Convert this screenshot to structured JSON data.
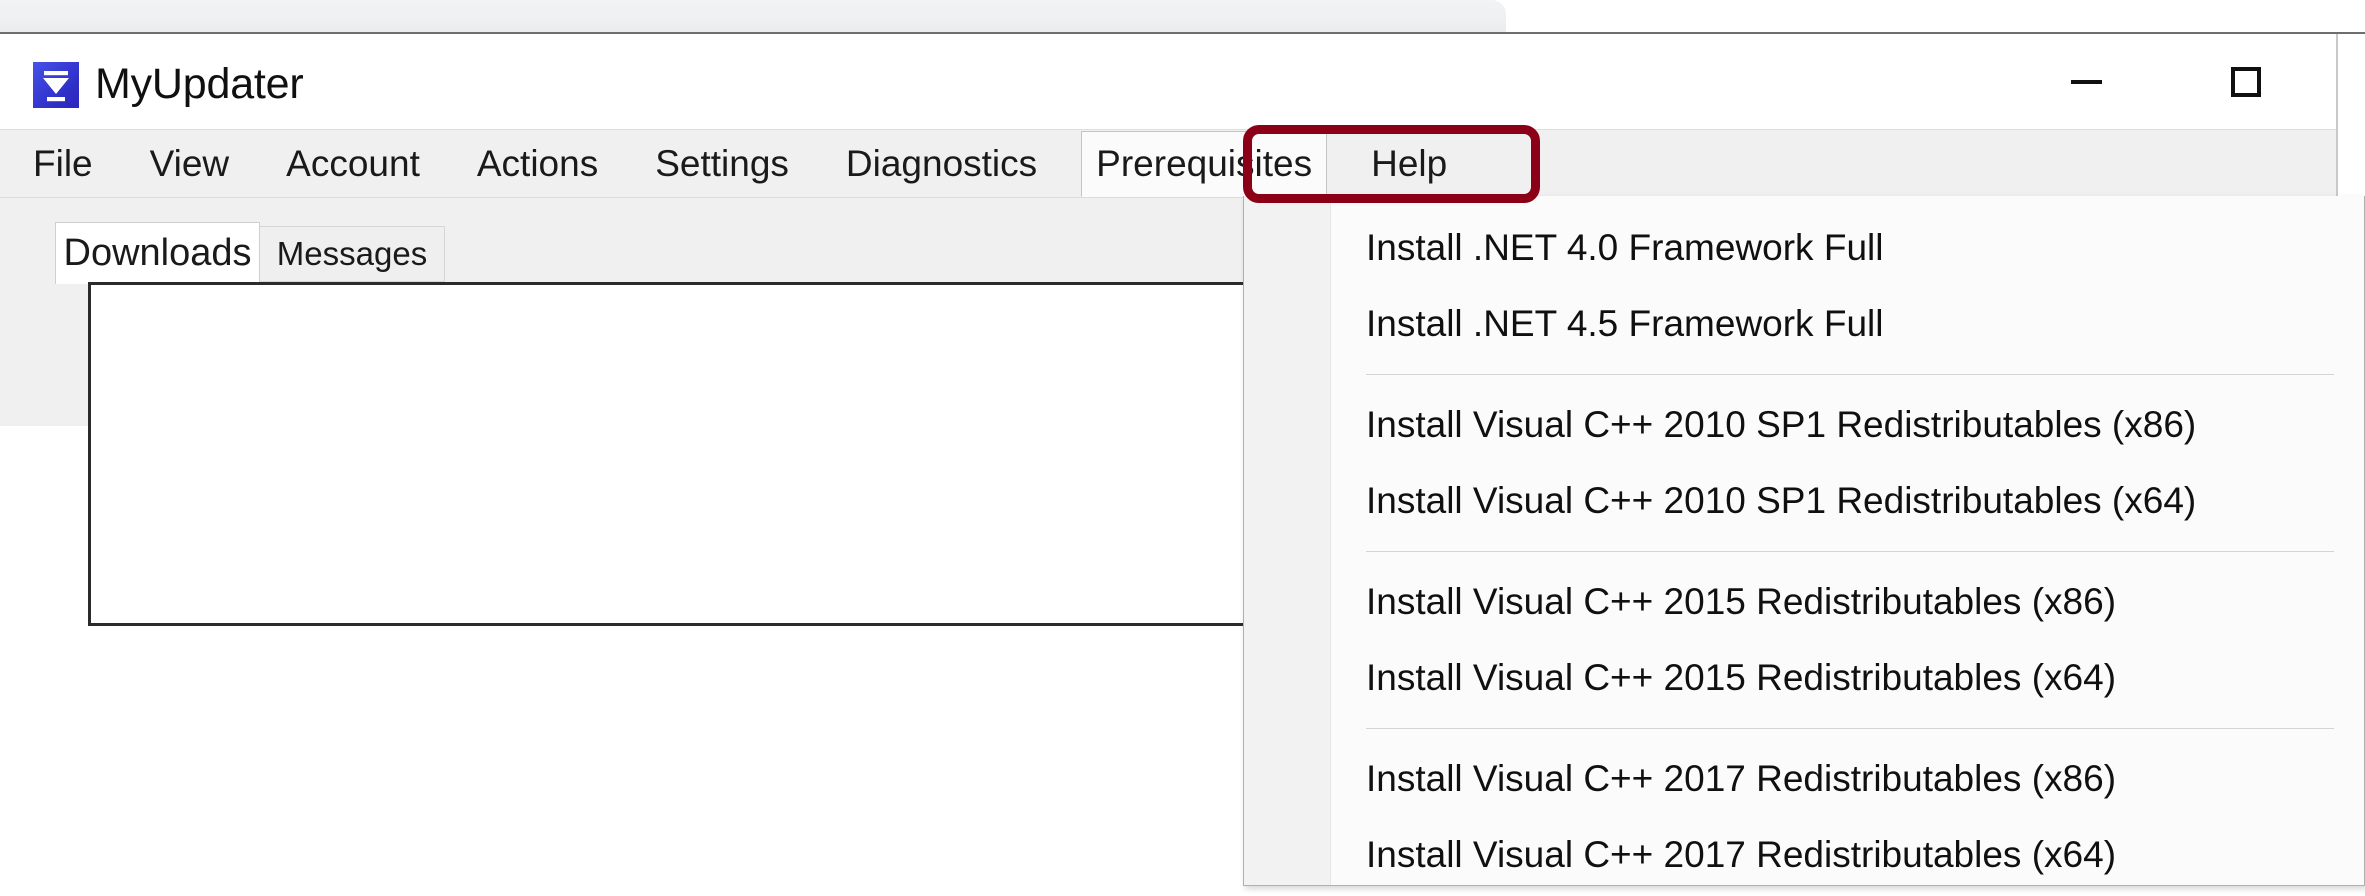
{
  "window": {
    "title": "MyUpdater",
    "icon": "download-app-icon",
    "controls": {
      "minimize_label": "—",
      "minimize_name": "minimize-icon",
      "maximize_label": "□",
      "maximize_name": "maximize-icon"
    }
  },
  "menubar": {
    "items": [
      {
        "label": "File",
        "active": false
      },
      {
        "label": "View",
        "active": false
      },
      {
        "label": "Account",
        "active": false
      },
      {
        "label": "Actions",
        "active": false
      },
      {
        "label": "Settings",
        "active": false
      },
      {
        "label": "Diagnostics",
        "active": false
      },
      {
        "label": "Prerequisites",
        "active": true
      },
      {
        "label": "Help",
        "active": false
      }
    ]
  },
  "highlight": {
    "target": "Prerequisites",
    "color": "#8b0016",
    "shape": "rounded-rectangle"
  },
  "tabs": [
    {
      "label": "Downloads",
      "selected": true
    },
    {
      "label": "Messages",
      "selected": false
    }
  ],
  "download_list": {
    "items": [],
    "empty": true
  },
  "dropdown": {
    "owner": "Prerequisites",
    "groups": [
      {
        "items": [
          "Install .NET 4.0 Framework Full",
          "Install .NET 4.5 Framework Full"
        ]
      },
      {
        "items": [
          "Install Visual C++ 2010 SP1 Redistributables (x86)",
          "Install Visual C++ 2010 SP1 Redistributables (x64)"
        ]
      },
      {
        "items": [
          "Install Visual C++ 2015 Redistributables (x86)",
          "Install Visual C++ 2015 Redistributables (x64)"
        ]
      },
      {
        "items": [
          "Install Visual C++ 2017 Redistributables (x86)",
          "Install Visual C++ 2017 Redistributables (x64)"
        ]
      }
    ]
  },
  "colors": {
    "menubar_bg": "#f0f0f0",
    "window_bg": "#ffffff",
    "dropdown_bg": "#fbfbfb",
    "gutter_bg": "#f2f2f2",
    "accent_highlight": "#8b0016",
    "icon_blue": "#2f2fc6"
  }
}
